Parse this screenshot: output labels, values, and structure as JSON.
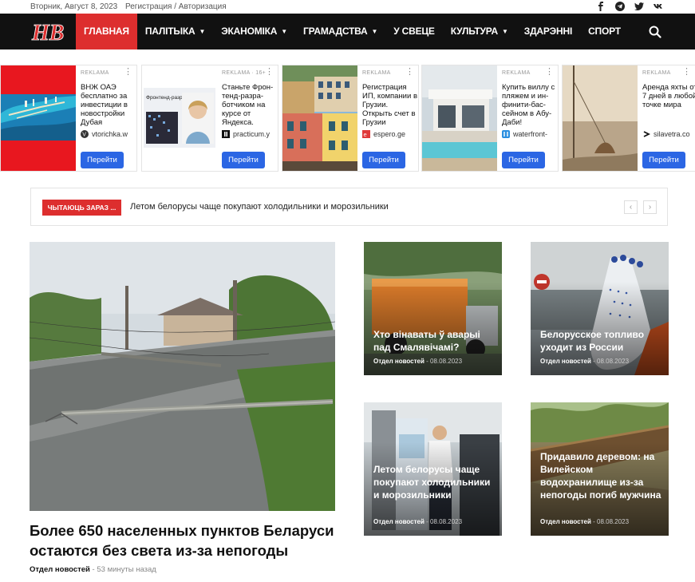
{
  "topbar": {
    "date": "Вторник, Август 8, 2023",
    "auth": "Регистрация / Авторизация",
    "social": [
      "facebook-icon",
      "telegram-icon",
      "twitter-icon",
      "vk-icon"
    ]
  },
  "brand": {
    "logo_text": "НВ",
    "accent": "#dd2e2e"
  },
  "nav": [
    {
      "label": "ГЛАВНАЯ",
      "active": true,
      "dropdown": false
    },
    {
      "label": "ПАЛІТЫКА",
      "active": false,
      "dropdown": true
    },
    {
      "label": "ЭКАНОМІКА",
      "active": false,
      "dropdown": true
    },
    {
      "label": "ГРАМАДСТВА",
      "active": false,
      "dropdown": true
    },
    {
      "label": "У СВЕЦЕ",
      "active": false,
      "dropdown": false
    },
    {
      "label": "КУЛЬТУРА",
      "active": false,
      "dropdown": true
    },
    {
      "label": "ЗДАРЭННІ",
      "active": false,
      "dropdown": false
    },
    {
      "label": "СПОРТ",
      "active": false,
      "dropdown": false
    }
  ],
  "ads": [
    {
      "label": "REKLAMA",
      "title": "ВНЖ ОАЭ бесплатно за инвестиции в новостройки Дубая",
      "domain": "vtorichka.w",
      "button": "Перейти"
    },
    {
      "label": "REKLAMA · 16+",
      "title": "Станьте Фрон-тенд-разра-ботчиком на курсе от Яндекса.",
      "domain": "practicum.y",
      "button": "Перейти",
      "img_text": "Фронтенд-разработчик"
    },
    {
      "label": "REKLAMA",
      "title": "Регистрация ИП, компании в Грузии. Открыть счет в Грузии",
      "domain": "espero.ge",
      "button": "Перейти"
    },
    {
      "label": "REKLAMA",
      "title": "Купить виллу с пляжем и ин-финити-бас-сейном в Абу-Даби!",
      "domain": "waterfront-",
      "button": "Перейти"
    },
    {
      "label": "REKLAMA",
      "title": "Аренда яхты от 7 дней в любой точке мира",
      "domain": "silavetra.co",
      "button": "Перейти"
    }
  ],
  "ticker": {
    "tag": "ЧЫТАЮЦЬ ЗАРАЗ ...",
    "text": "Летом белорусы чаще покупают холодильники и морозильники",
    "prev": "‹",
    "next": "›"
  },
  "main_story": {
    "title": "Более 650 населенных пунктов Беларуси остаются без света из-за непогоды",
    "author": "Отдел новостей",
    "separator": "-",
    "time": "53 минуты назад"
  },
  "cards": [
    {
      "title": "Хто вінаваты ў аварыі пад Смалявічамі?",
      "author": "Отдел новостей",
      "date": "08.08.2023"
    },
    {
      "title": "Белорусское топливо уходит из России",
      "author": "Отдел новостей",
      "date": "08.08.2023"
    },
    {
      "title": "Летом белорусы чаще покупают холодильники и морозильники",
      "author": "Отдел новостей",
      "date": "08.08.2023"
    },
    {
      "title": "Придавило деревом: на Вилейском водохранилище из-за непогоды погиб мужчина",
      "author": "Отдел новостей",
      "date": "08.08.2023"
    }
  ]
}
